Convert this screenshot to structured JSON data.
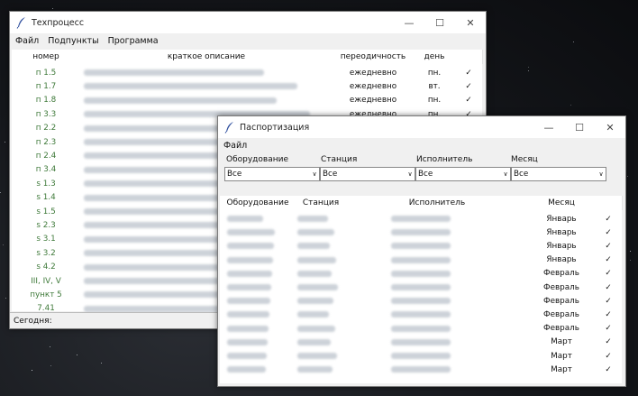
{
  "tech_window": {
    "title": "Техпроцесс",
    "menu": [
      "Файл",
      "Подпункты",
      "Программа"
    ],
    "columns": [
      "номер",
      "краткое описание",
      "переодичность",
      "день",
      ""
    ],
    "rows": [
      {
        "num": "п 1.5",
        "period": "ежедневно",
        "day": "пн.",
        "check": "✓"
      },
      {
        "num": "п 1.7",
        "period": "ежедневно",
        "day": "вт.",
        "check": "✓"
      },
      {
        "num": "п 1.8",
        "period": "ежедневно",
        "day": "пн.",
        "check": "✓"
      },
      {
        "num": "п 3.3",
        "period": "ежедневно",
        "day": "пн.",
        "check": "✓"
      },
      {
        "num": "п 2.2",
        "period": "",
        "day": "",
        "check": ""
      },
      {
        "num": "п 2.3",
        "period": "",
        "day": "",
        "check": ""
      },
      {
        "num": "п 2.4",
        "period": "",
        "day": "",
        "check": ""
      },
      {
        "num": "п 3.4",
        "period": "",
        "day": "",
        "check": ""
      },
      {
        "num": "s 1.3",
        "period": "",
        "day": "",
        "check": ""
      },
      {
        "num": "s 1.4",
        "period": "",
        "day": "",
        "check": ""
      },
      {
        "num": "s 1.5",
        "period": "",
        "day": "",
        "check": ""
      },
      {
        "num": "s 2.3",
        "period": "",
        "day": "",
        "check": ""
      },
      {
        "num": "s 3.1",
        "period": "",
        "day": "",
        "check": ""
      },
      {
        "num": "s 3.2",
        "period": "",
        "day": "",
        "check": ""
      },
      {
        "num": "s 4.2",
        "period": "",
        "day": "",
        "check": ""
      },
      {
        "num": "III, IV, V",
        "period": "",
        "day": "",
        "check": ""
      },
      {
        "num": "пункт 5",
        "period": "",
        "day": "",
        "check": ""
      },
      {
        "num": "7.41",
        "period": "",
        "day": "",
        "check": ""
      }
    ],
    "status": "Сегодня:"
  },
  "pass_window": {
    "title": "Паспортизация",
    "menu": [
      "Файл"
    ],
    "filters": [
      {
        "label": "Оборудование",
        "value": "Все"
      },
      {
        "label": "Станция",
        "value": "Все"
      },
      {
        "label": "Исполнитель",
        "value": "Все"
      },
      {
        "label": "Месяц",
        "value": "Все"
      }
    ],
    "columns": [
      "Оборудование",
      "Станция",
      "Исполнитель",
      "Месяц",
      ""
    ],
    "rows": [
      {
        "month": "Январь",
        "check": "✓"
      },
      {
        "month": "Январь",
        "check": "✓"
      },
      {
        "month": "Январь",
        "check": "✓"
      },
      {
        "month": "Январь",
        "check": "✓"
      },
      {
        "month": "Февраль",
        "check": "✓"
      },
      {
        "month": "Февраль",
        "check": "✓"
      },
      {
        "month": "Февраль",
        "check": "✓"
      },
      {
        "month": "Февраль",
        "check": "✓"
      },
      {
        "month": "Февраль",
        "check": "✓"
      },
      {
        "month": "Март",
        "check": "✓"
      },
      {
        "month": "Март",
        "check": "✓"
      },
      {
        "month": "Март",
        "check": "✓"
      }
    ]
  },
  "colors": {
    "accent_green": "#3f7a3a",
    "header_bg": "#ffffff",
    "window_bg": "#f0f0f0"
  },
  "icons": {
    "app": "feather-icon",
    "minimize": "minimize-icon",
    "maximize": "maximize-icon",
    "close": "close-icon",
    "dropdown": "chevron-down-icon"
  }
}
